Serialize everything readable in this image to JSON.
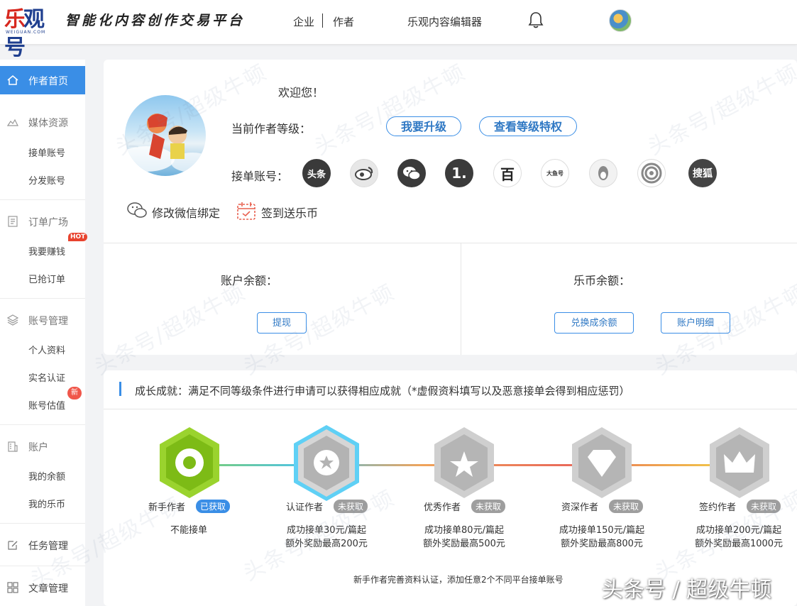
{
  "header": {
    "logo_text": "乐观号",
    "logo_sub": "WEIGUAN.COM",
    "slogan": "智能化内容创作交易平台",
    "nav_enterprise": "企业",
    "nav_author": "作者",
    "nav_editor": "乐观内容编辑器"
  },
  "sidebar": {
    "home": "作者首页",
    "media": "媒体资源",
    "media_items": [
      "接单账号",
      "分发账号"
    ],
    "orders": "订单广场",
    "order_items": [
      "我要赚钱",
      "已抢订单"
    ],
    "hot": "HOT",
    "account_mgmt": "账号管理",
    "account_items": [
      "个人资料",
      "实名认证",
      "账号估值"
    ],
    "new": "新",
    "account": "账户",
    "wallet_items": [
      "我的余额",
      "我的乐币"
    ],
    "tasks": "任务管理",
    "articles": "文章管理"
  },
  "profile": {
    "welcome": "欢迎您！",
    "level_label": "当前作者等级：",
    "upgrade_btn": "我要升级",
    "privileges_btn": "查看等级特权",
    "accounts_label": "接单账号：",
    "platforms": [
      "头条",
      "微博",
      "微信",
      "1.",
      "百",
      "大鱼号",
      "企鹅",
      "网易",
      "搜狐"
    ],
    "wechat_bind": "修改微信绑定",
    "checkin": "签到送乐币",
    "balance_label": "账户余额：",
    "withdraw_btn": "提现",
    "coin_label": "乐币余额：",
    "exchange_btn": "兑换成余额",
    "detail_btn": "账户明细"
  },
  "growth": {
    "title": "成长成就：满足不同等级条件进行申请可以获得相应成就（*虚假资料填写以及恶意接单会得到相应惩罚）",
    "levels": [
      {
        "name": "新手作者",
        "status": "已获取",
        "desc1": "不能接单",
        "desc2": ""
      },
      {
        "name": "认证作者",
        "status": "未获取",
        "desc1": "成功接单30元/篇起",
        "desc2": "额外奖励最高200元"
      },
      {
        "name": "优秀作者",
        "status": "未获取",
        "desc1": "成功接单80元/篇起",
        "desc2": "额外奖励最高500元"
      },
      {
        "name": "资深作者",
        "status": "未获取",
        "desc1": "成功接单150元/篇起",
        "desc2": "额外奖励最高800元"
      },
      {
        "name": "签约作者",
        "status": "未获取",
        "desc1": "成功接单200元/篇起",
        "desc2": "额外奖励最高1000元"
      }
    ],
    "footnote": "新手作者完善资料认证，添加任意2个不同平台接单账号"
  },
  "watermark": "头条号/超级牛顿",
  "corner_watermark": "头条号 / 超级牛顿"
}
